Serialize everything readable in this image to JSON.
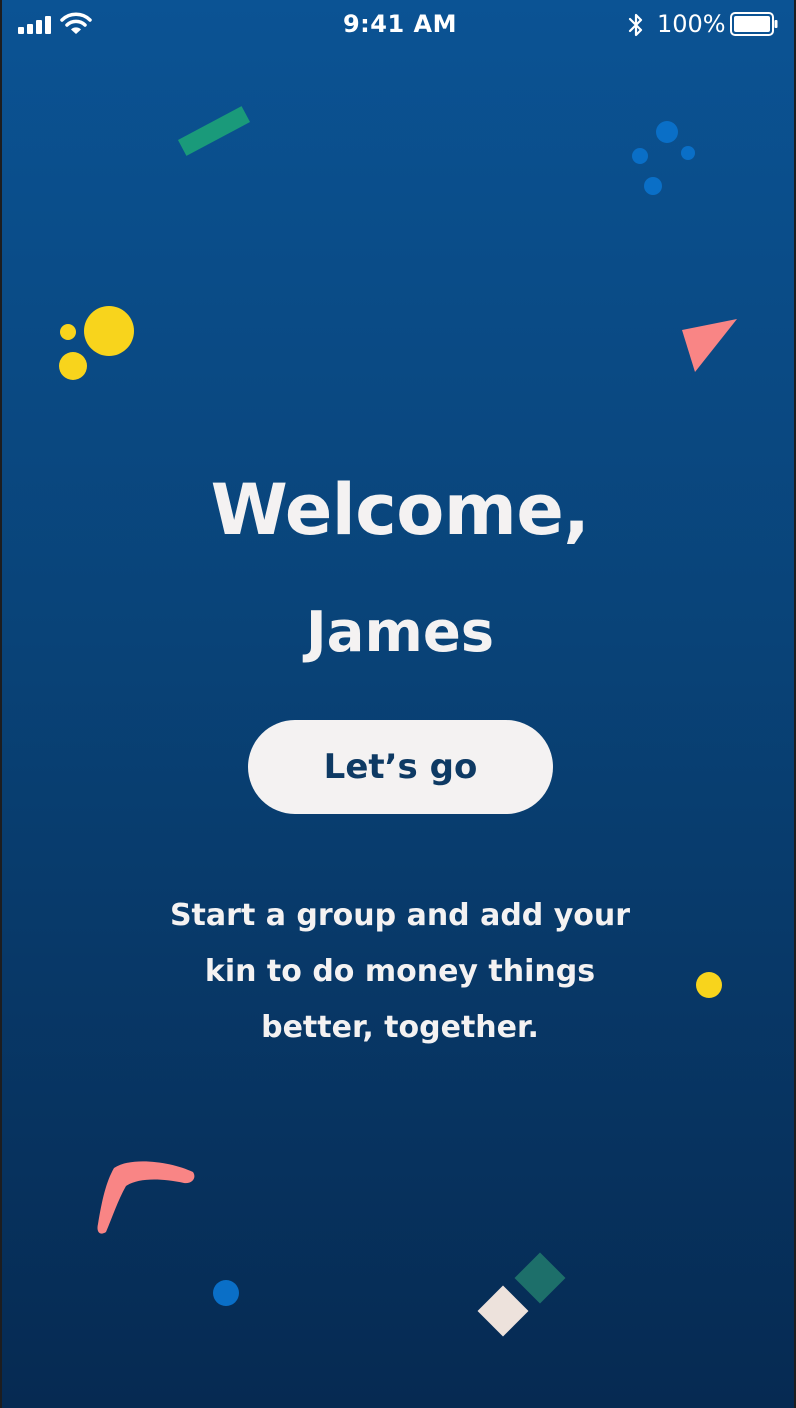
{
  "status_bar": {
    "time": "9:41 AM",
    "battery_percent": "100%",
    "signal_icon": "cellular-signal-icon",
    "wifi_icon": "wifi-icon",
    "bluetooth_icon": "bluetooth-icon",
    "battery_icon": "battery-full-icon"
  },
  "welcome": {
    "greeting": "Welcome,",
    "name": "James",
    "cta_label": "Let’s go",
    "tagline_lines": [
      "Start a group and add your",
      "kin to do money things",
      "better, together."
    ]
  },
  "colors": {
    "background_top": "#0b5394",
    "background_bottom": "#062a52",
    "text_light": "#f4f2f2",
    "cta_text": "#0e3a64",
    "confetti_green": "#1a9a7a",
    "confetti_blue": "#0a6fc7",
    "confetti_yellow": "#f8d41c",
    "confetti_coral": "#f98585",
    "confetti_teal": "#1d6f6a",
    "confetti_cream": "#ede2dc"
  }
}
